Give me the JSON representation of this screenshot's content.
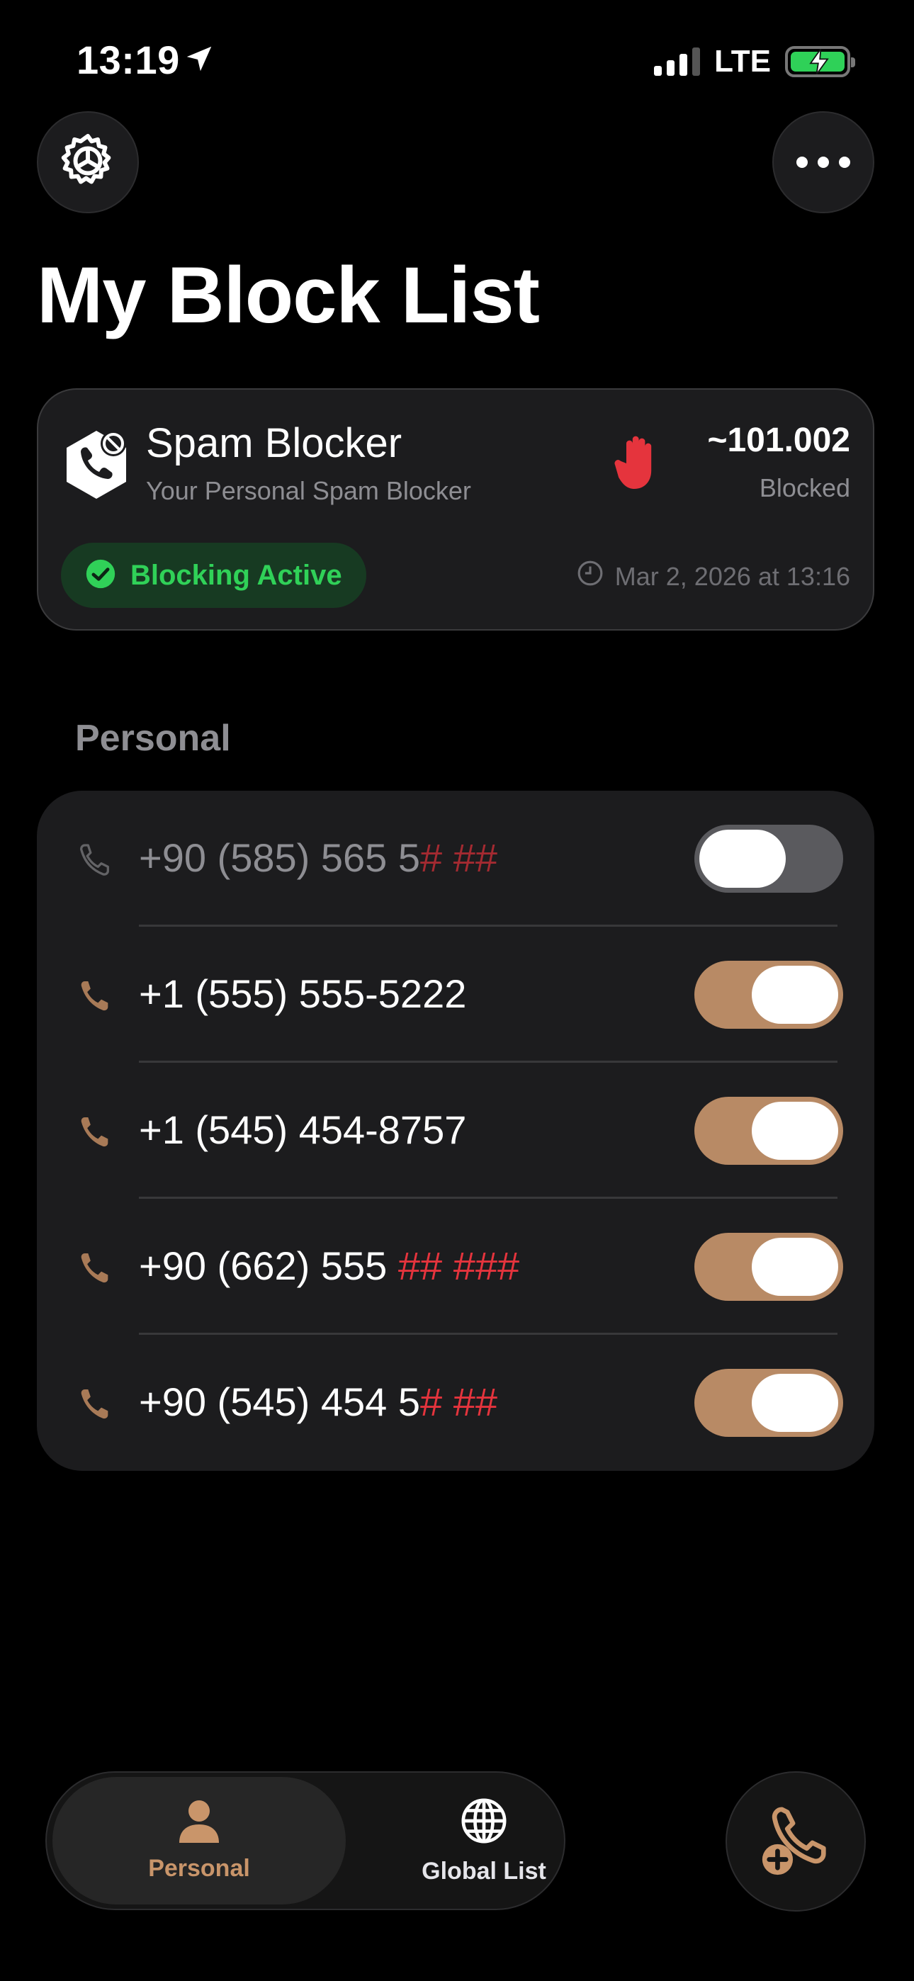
{
  "status_bar": {
    "time": "13:19",
    "network": "LTE"
  },
  "header": {
    "title": "My Block List"
  },
  "blocker_card": {
    "title": "Spam Blocker",
    "subtitle": "Your Personal Spam Blocker",
    "blocked_count": "~101.002",
    "blocked_label": "Blocked",
    "status": "Blocking Active",
    "timestamp": "Mar 2, 2026 at 13:16"
  },
  "section": {
    "label": "Personal"
  },
  "numbers": [
    {
      "prefix": "+90 (585) 565 5",
      "masked": "# ##",
      "enabled": false
    },
    {
      "prefix": "+1 (555) 555-5222",
      "masked": "",
      "enabled": true
    },
    {
      "prefix": "+1 (545) 454-8757",
      "masked": "",
      "enabled": true
    },
    {
      "prefix": "+90 (662) 555 ",
      "masked": "## ###",
      "enabled": true
    },
    {
      "prefix": "+90 (545) 454 5",
      "masked": "# ##",
      "enabled": true
    }
  ],
  "tabs": [
    {
      "label": "Personal",
      "icon": "person-icon",
      "active": true
    },
    {
      "label": "Global List",
      "icon": "globe-icon",
      "active": false
    }
  ],
  "colors": {
    "accent": "#b88a65",
    "active_green": "#30d158",
    "mask_red": "#e5343d",
    "card_bg": "#1c1c1e"
  }
}
